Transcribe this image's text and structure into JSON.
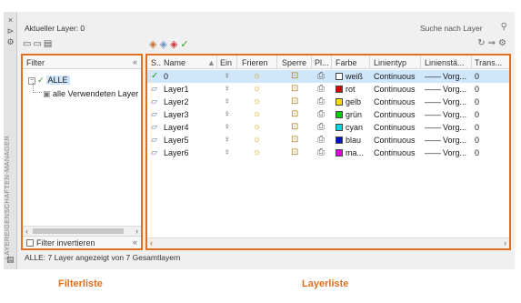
{
  "window": {
    "vertical_title": "LAYEREIGENSCHAFTEN-MANAGER",
    "controls": [
      "×",
      "⊳",
      "⚙"
    ],
    "current_layer": "Aktueller Layer: 0",
    "search_placeholder": "Suche nach Layer"
  },
  "toolbar_left": [
    "new-filter-icon",
    "new-group-filter-icon",
    "layer-states-icon"
  ],
  "toolbar_mid": [
    "new-layer-icon",
    "new-layer-frozen-icon",
    "delete-layer-icon",
    "set-current-icon"
  ],
  "toolbar_right": [
    "refresh-icon",
    "merge-icon",
    "settings-icon"
  ],
  "filter": {
    "header": "Filter",
    "collapse": "«",
    "root": "ALLE",
    "child": "alle Verwendeten Layer",
    "invert_label": "Filter invertieren",
    "invert_checked": false
  },
  "grid": {
    "columns": [
      "S..",
      "Name",
      "Ein",
      "Frieren",
      "Sperre",
      "Pl...",
      "Farbe",
      "Linientyp",
      "Linienstä...",
      "Trans..."
    ],
    "rows": [
      {
        "status": "current",
        "name": "0",
        "color": "weiß",
        "color_hex": "#ffffff",
        "linetype": "Continuous",
        "lineweight": "Vorg...",
        "trans": "0",
        "selected": true
      },
      {
        "status": "layer",
        "name": "Layer1",
        "color": "rot",
        "color_hex": "#e00000",
        "linetype": "Continuous",
        "lineweight": "Vorg...",
        "trans": "0",
        "selected": false
      },
      {
        "status": "layer",
        "name": "Layer2",
        "color": "gelb",
        "color_hex": "#ffe000",
        "linetype": "Continuous",
        "lineweight": "Vorg...",
        "trans": "0",
        "selected": false
      },
      {
        "status": "layer",
        "name": "Layer3",
        "color": "grün",
        "color_hex": "#00d000",
        "linetype": "Continuous",
        "lineweight": "Vorg...",
        "trans": "0",
        "selected": false
      },
      {
        "status": "layer",
        "name": "Layer4",
        "color": "cyan",
        "color_hex": "#00d8e8",
        "linetype": "Continuous",
        "lineweight": "Vorg...",
        "trans": "0",
        "selected": false
      },
      {
        "status": "layer",
        "name": "Layer5",
        "color": "blau",
        "color_hex": "#0010d0",
        "linetype": "Continuous",
        "lineweight": "Vorg...",
        "trans": "0",
        "selected": false
      },
      {
        "status": "layer",
        "name": "Layer6",
        "color": "ma...",
        "color_hex": "#e000e0",
        "linetype": "Continuous",
        "lineweight": "Vorg...",
        "trans": "0",
        "selected": false
      }
    ]
  },
  "status_bar": "ALLE: 7 Layer angezeigt von 7 Gesamtlayern",
  "captions": {
    "filter": "Filterliste",
    "layer": "Layerliste"
  },
  "accent": "#e07020"
}
